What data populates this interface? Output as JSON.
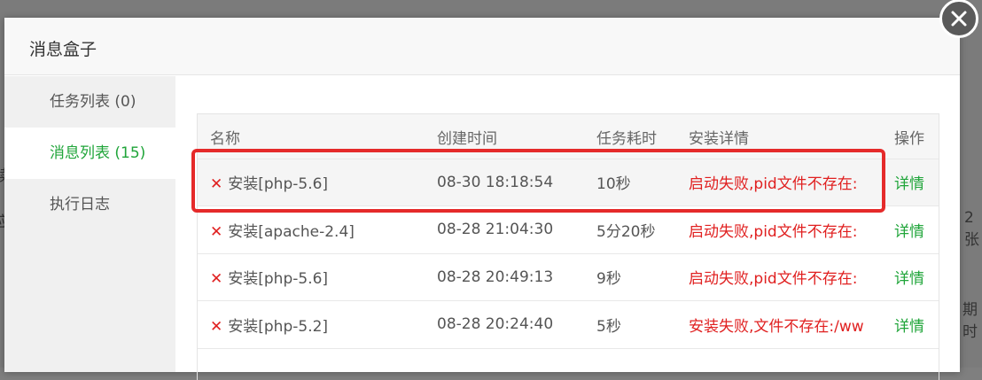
{
  "dialog": {
    "title": "消息盒子"
  },
  "sidebar": {
    "items": [
      {
        "label": "任务列表 (0)"
      },
      {
        "label": "消息列表 (15)"
      },
      {
        "label": "执行日志"
      }
    ]
  },
  "table": {
    "headers": [
      "名称",
      "创建时间",
      "任务耗时",
      "安装详情",
      "操作"
    ],
    "rows": [
      {
        "name": "安装[php-5.6]",
        "time": "08-30 18:18:54",
        "duration": "10秒",
        "detail": "启动失败,pid文件不存在:",
        "op": "详情"
      },
      {
        "name": "安装[apache-2.4]",
        "time": "08-28 21:04:30",
        "duration": "5分20秒",
        "detail": "启动失败,pid文件不存在:",
        "op": "详情"
      },
      {
        "name": "安装[php-5.6]",
        "time": "08-28 20:49:13",
        "duration": "9秒",
        "detail": "启动失败,pid文件不存在:",
        "op": "详情"
      },
      {
        "name": "安装[php-5.2]",
        "time": "08-28 20:24:40",
        "duration": "5秒",
        "detail": "安装失败,文件不存在:/ww",
        "op": "详情"
      }
    ]
  },
  "background": {
    "hint1": "2张",
    "hint2": "期时",
    "hint3": "读",
    "hint4": "应"
  },
  "colors": {
    "accent_green": "#20a53a",
    "error_red": "#e02020",
    "highlight_border": "#e52a2a"
  }
}
